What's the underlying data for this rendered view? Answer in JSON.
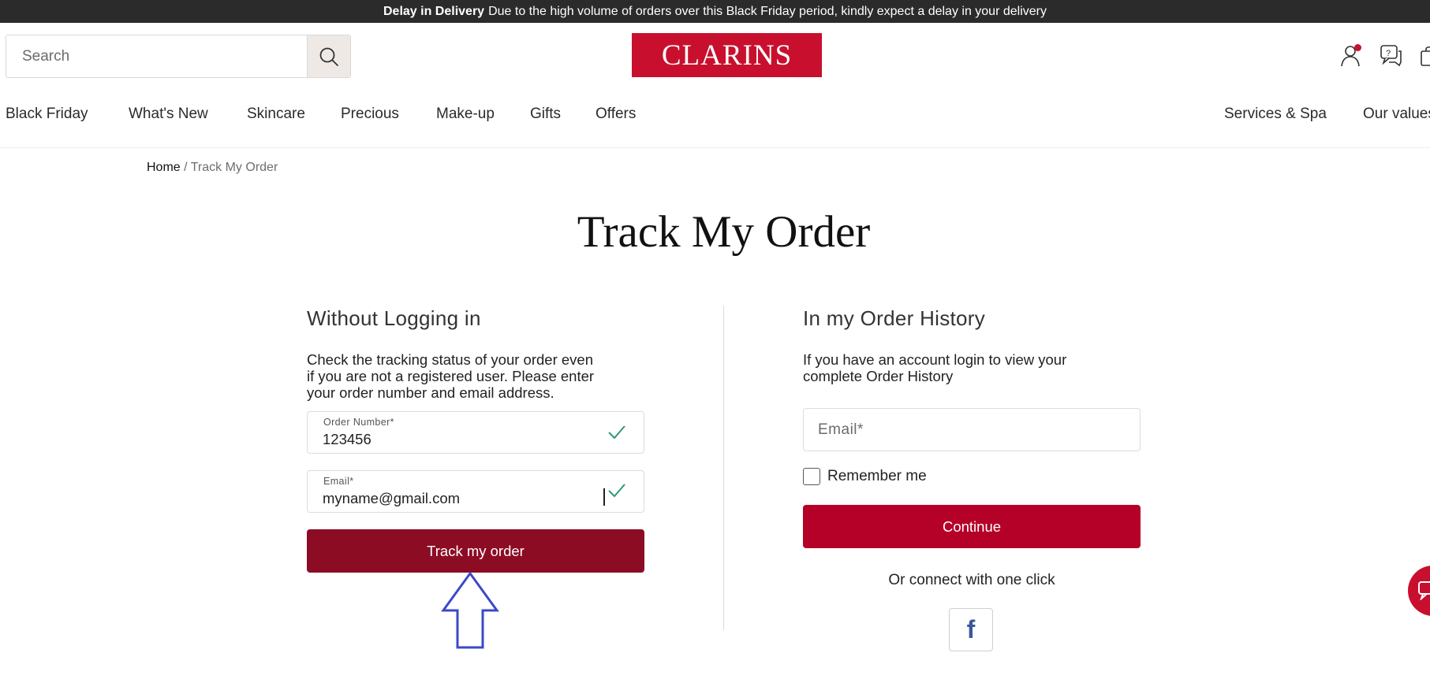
{
  "banner": {
    "bold": "Delay in Delivery",
    "text": "Due to the high volume of orders over this Black Friday period, kindly expect a delay in your delivery"
  },
  "search": {
    "placeholder": "Search"
  },
  "logo": {
    "text": "CLARINS"
  },
  "nav": {
    "left": [
      "Black Friday",
      "What's New",
      "Skincare",
      "Precious",
      "Make-up",
      "Gifts",
      "Offers"
    ],
    "right": [
      "Services & Spa",
      "Our values"
    ]
  },
  "breadcrumb": {
    "home": "Home",
    "separator": "/",
    "current": "Track My Order"
  },
  "page_title": "Track My Order",
  "guest": {
    "title": "Without Logging in",
    "text_lines": [
      "Check the tracking status of your order even",
      "if you are not a registered user. Please enter",
      "your order number and email address."
    ],
    "order_label": "Order Number*",
    "order_value": "123456",
    "email_label": "Email*",
    "email_value": "myname@gmail.com",
    "button": "Track my order"
  },
  "history": {
    "title": "In my Order History",
    "text_lines": [
      "If you have an account login to view your",
      "complete Order History"
    ],
    "email_placeholder": "Email*",
    "remember": "Remember me",
    "button": "Continue",
    "connect": "Or connect with one click",
    "facebook": "f"
  },
  "colors": {
    "brand_red": "#c8102e",
    "track_button": "#8c0c24",
    "continue_button": "#b50027",
    "check_green": "#2e9b73",
    "arrow_blue": "#3b49c8"
  },
  "icons": [
    "search-icon",
    "account-icon",
    "help-chat-icon",
    "bag-icon",
    "check-icon",
    "facebook-icon",
    "chat-icon",
    "arrow-up-icon"
  ]
}
